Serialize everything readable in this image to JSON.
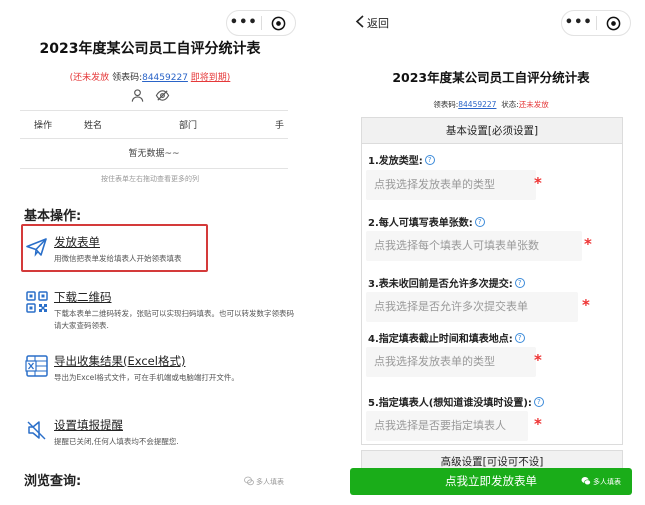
{
  "left": {
    "title": "2023年度某公司员工自评分统计表",
    "status": "(还未发放",
    "form_code_label": "领表码:",
    "form_code": "84459227",
    "due_link": "即将到期)",
    "table": {
      "columns": [
        "操作",
        "姓名",
        "部门",
        "手"
      ],
      "empty_text": "暂无数据~~"
    },
    "table_hint": "按住表单左右拖动查看更多的列",
    "basic_ops_title": "基本操作:",
    "ops": [
      {
        "title": "发放表单",
        "desc": "用微信把表单发给填表人开始领表填表"
      },
      {
        "title": "下载二维码",
        "desc": "下载本表单二维码转发，张贴可以实现扫码填表。也可以转发数字领表码请大家查码领表."
      },
      {
        "title": "导出收集结果(Excel格式)",
        "desc": "导出为Excel格式文件，可在手机端或电脑端打开文件。"
      },
      {
        "title": "设置填报提醒",
        "desc": "提醒已关闭,任何人填表均不会提醒您."
      }
    ],
    "browse_title": "浏览查询:",
    "brand": "多人填表"
  },
  "right": {
    "back_label": "返回",
    "title": "2023年度某公司员工自评分统计表",
    "form_code_label": "领表码:",
    "form_code": "84459227",
    "status_label": "状态:",
    "status_value": "还未发放",
    "basic_settings": "基本设置[必须设置]",
    "questions": [
      {
        "label": "1.发放类型:",
        "placeholder": "点我选择发放表单的类型"
      },
      {
        "label": "2.每人可填写表单张数:",
        "placeholder": "点我选择每个填表人可填表单张数"
      },
      {
        "label": "3.表未收回前是否允许多次提交:",
        "placeholder": "点我选择是否允许多次提交表单"
      },
      {
        "label": "4.指定填表截止时间和填表地点:",
        "placeholder": "点我选择发放表单的类型"
      },
      {
        "label": "5.指定填表人(想知道谁没填时设置):",
        "placeholder": "点我选择是否要指定填表人"
      }
    ],
    "required_mark": "*",
    "help_mark": "?",
    "advanced_settings": "高级设置[可设可不设]",
    "submit_button": "点我立即发放表单",
    "brand": "多人填表"
  },
  "capsule": {
    "dots": "•••"
  },
  "colors": {
    "accent_red": "#e5393a",
    "link_blue": "#2a64c8",
    "wechat_green": "#1aad19",
    "highlight_border": "#d43a3a"
  }
}
